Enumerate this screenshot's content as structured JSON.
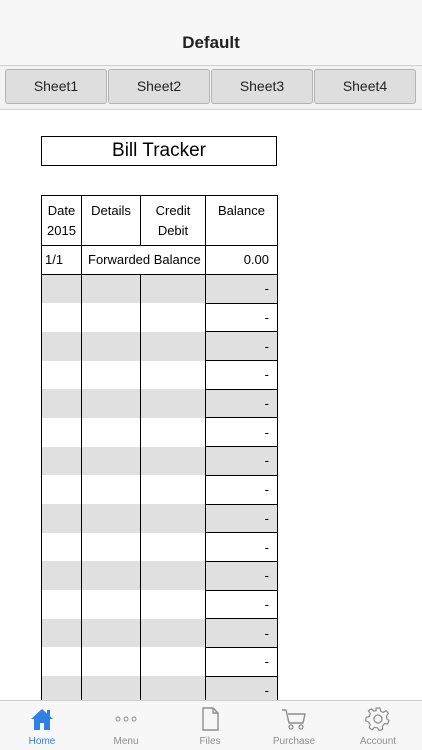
{
  "nav": {
    "title": "Default"
  },
  "sheet_tabs": [
    {
      "label": "Sheet1"
    },
    {
      "label": "Sheet2"
    },
    {
      "label": "Sheet3"
    },
    {
      "label": "Sheet4"
    }
  ],
  "sheet": {
    "title": "Bill Tracker",
    "headers": {
      "date_line1": "Date",
      "date_line2": "2015",
      "details": "Details",
      "credit": "Credit",
      "debit": "Debit",
      "balance": "Balance"
    },
    "first_row": {
      "date": "1/1",
      "details": "Forwarded Balance",
      "balance": "0.00"
    },
    "rows": [
      {
        "balance": "-"
      },
      {
        "balance": "-"
      },
      {
        "balance": "-"
      },
      {
        "balance": "-"
      },
      {
        "balance": "-"
      },
      {
        "balance": "-"
      },
      {
        "balance": "-"
      },
      {
        "balance": "-"
      },
      {
        "balance": "-"
      },
      {
        "balance": "-"
      },
      {
        "balance": "-"
      },
      {
        "balance": "-"
      },
      {
        "balance": "-"
      },
      {
        "balance": "-"
      },
      {
        "balance": "-"
      }
    ]
  },
  "tab_bar": {
    "items": [
      {
        "label": "Home",
        "icon": "home-icon",
        "active": true
      },
      {
        "label": "Menu",
        "icon": "more-dots-icon",
        "active": false
      },
      {
        "label": "Files",
        "icon": "file-icon",
        "active": false
      },
      {
        "label": "Purchase",
        "icon": "cart-icon",
        "active": false
      },
      {
        "label": "Account",
        "icon": "gear-icon",
        "active": false
      }
    ],
    "active_color": "#2f7fe6",
    "inactive_color": "#8e8e8e"
  }
}
